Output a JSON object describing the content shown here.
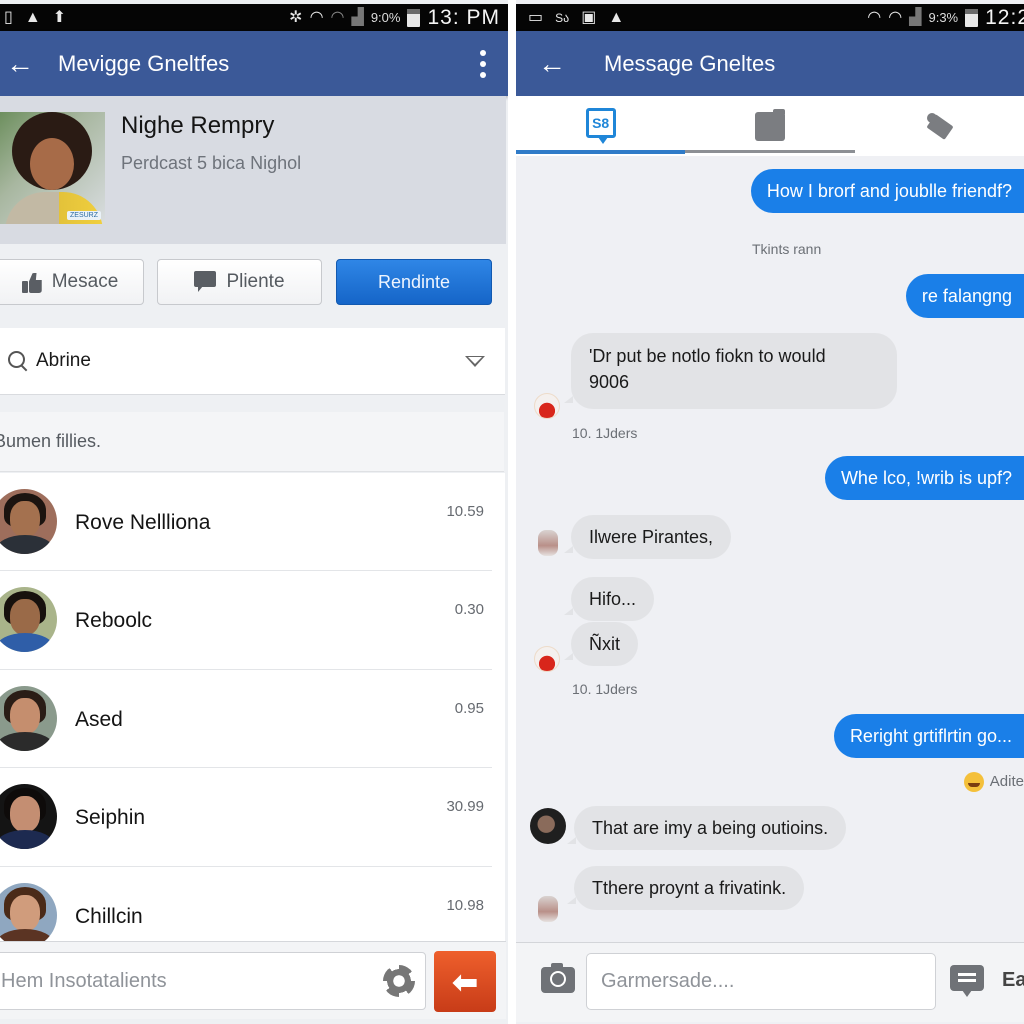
{
  "left_screen": {
    "status_bar": {
      "left_icons": [
        "notification-icon",
        "warning-icon",
        "upload-icon"
      ],
      "right_icons": [
        "bluetooth-icon",
        "wifi-icon",
        "wifi-weak-icon",
        "signal-icon"
      ],
      "battery_percent": "9:0%",
      "clock": "13: PM"
    },
    "app_bar": {
      "title": "Mevigge Gneltfes",
      "back_icon": "arrow-left-icon",
      "menu_icon": "more-vert-icon"
    },
    "profile": {
      "name": "Nighe Rempry",
      "subtitle": "Perdcast 5 bica Nighol",
      "photo_tag": "ZESURZ"
    },
    "actions": {
      "like_label": "Mesace",
      "comment_label": "Pliente",
      "primary_label": "Rendinte"
    },
    "search": {
      "value": "Abrine"
    },
    "section_label": "Bumen fillies.",
    "contacts": [
      {
        "name": "Rove Nellliona",
        "time": "10.59"
      },
      {
        "name": "Reboolc",
        "time": "0.30"
      },
      {
        "name": "Ased",
        "time": "0.95"
      },
      {
        "name": "Seiphin",
        "time": "30.99"
      },
      {
        "name": "Chillcin",
        "time": "10.98"
      }
    ],
    "composer": {
      "placeholder": "Hem Insotatalients",
      "send_icon": "arrow-left-icon"
    }
  },
  "right_screen": {
    "status_bar": {
      "left_icons": [
        "cast-icon",
        "text-icon",
        "image-icon",
        "warning-icon"
      ],
      "right_icons": [
        "wifi-icon",
        "wifi-icon",
        "signal-icon"
      ],
      "battery_percent": "9:3%",
      "clock": "12:2"
    },
    "app_bar": {
      "title": "Message Gneltes",
      "back_icon": "arrow-left-icon"
    },
    "tabs": [
      {
        "icon": "chat-icon",
        "active": true
      },
      {
        "icon": "folder-icon",
        "active": false
      },
      {
        "icon": "tools-icon",
        "active": false
      }
    ],
    "chat_tab_glyph": "S8",
    "messages": [
      {
        "type": "out",
        "text": "How I brorf and joublle friendf?"
      },
      {
        "type": "system",
        "text": "Tkints rann"
      },
      {
        "type": "out",
        "text": "re falangng"
      },
      {
        "type": "in",
        "text_line1": "'Dr put be notlo fiokn to would",
        "text_line2": "9006"
      },
      {
        "type": "timestamp",
        "text": "10. 1Jders"
      },
      {
        "type": "out",
        "text": "Whe lco, !wrib is upf?"
      },
      {
        "type": "in",
        "text": "Ilwere Pirantes,"
      },
      {
        "type": "in",
        "text": "Hifo..."
      },
      {
        "type": "in",
        "text": "Ñxit"
      },
      {
        "type": "timestamp",
        "text": "10. 1Jders"
      },
      {
        "type": "out",
        "text": "Reright grtiflrtin go..."
      },
      {
        "type": "reaction",
        "text": "Adite"
      },
      {
        "type": "in",
        "text": "That are imy a being outioins."
      },
      {
        "type": "in",
        "text": "Tthere proynt a frivatink."
      }
    ],
    "composer": {
      "placeholder": "Garmersade....",
      "trailing_label": "Ea"
    }
  },
  "colors": {
    "app_bar": "#3b5998",
    "outgoing_bubble": "#1a7fe8",
    "incoming_bubble": "#e2e3e6",
    "primary_button": "#1f74d8",
    "send_button": "#e0522a",
    "active_tab": "#2f7bc8"
  }
}
